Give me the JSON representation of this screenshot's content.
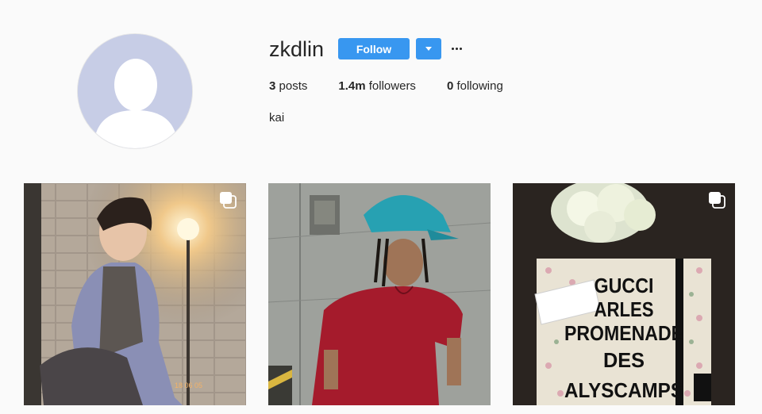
{
  "profile": {
    "username": "zkdlin",
    "follow_label": "Follow",
    "stats": {
      "posts_count": "3",
      "posts_label": " posts",
      "followers_count": "1.4m",
      "followers_label": " followers",
      "following_count": "0",
      "following_label": " following"
    },
    "bio": "kai"
  },
  "posts": [
    {
      "stamp": "18 06 05",
      "icon": "multiple-photos-icon"
    },
    {
      "icon": "none"
    },
    {
      "sign_lines": [
        "GUCCI",
        "ARLES",
        "PROMENADE",
        "DES",
        "ALYSCAMPS"
      ],
      "icon": "multiple-photos-icon"
    }
  ],
  "colors": {
    "follow_blue": "#3897f0",
    "background": "#fafafa",
    "avatar_bg": "#c7cde6"
  }
}
